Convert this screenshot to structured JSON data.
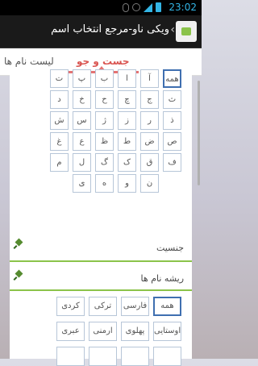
{
  "status_bar": {
    "time": "23:02"
  },
  "action_bar": {
    "title": "ویکی ناو-مرجع انتخاب اسم"
  },
  "tabs": [
    {
      "label": "جست و جو",
      "active": true
    },
    {
      "label": "لیست نام ها",
      "active": false
    }
  ],
  "alphabet": {
    "selected": "همه",
    "rows": [
      [
        "همه",
        "آ",
        "ا",
        "ب",
        "پ",
        "ت"
      ],
      [
        "ث",
        "ج",
        "چ",
        "ح",
        "خ",
        "د"
      ],
      [
        "ذ",
        "ر",
        "ز",
        "ژ",
        "س",
        "ش"
      ],
      [
        "ص",
        "ض",
        "ط",
        "ظ",
        "ع",
        "غ"
      ],
      [
        "ف",
        "ق",
        "ک",
        "گ",
        "ل",
        "م"
      ],
      [
        "ن",
        "و",
        "ه",
        "ی"
      ]
    ]
  },
  "gender_section": {
    "label": "جنسیت"
  },
  "origin_section": {
    "label": "ریشه نام ها",
    "options": [
      [
        "همه",
        "فارسی",
        "ترکی",
        "کردی"
      ],
      [
        "اوستایی",
        "پهلوی",
        "ارمنی",
        "عبری"
      ]
    ],
    "selected": "همه"
  },
  "colors": {
    "accent": "#e57373",
    "section_divider": "#8bc34a",
    "selection_border": "#3f6fb0"
  }
}
